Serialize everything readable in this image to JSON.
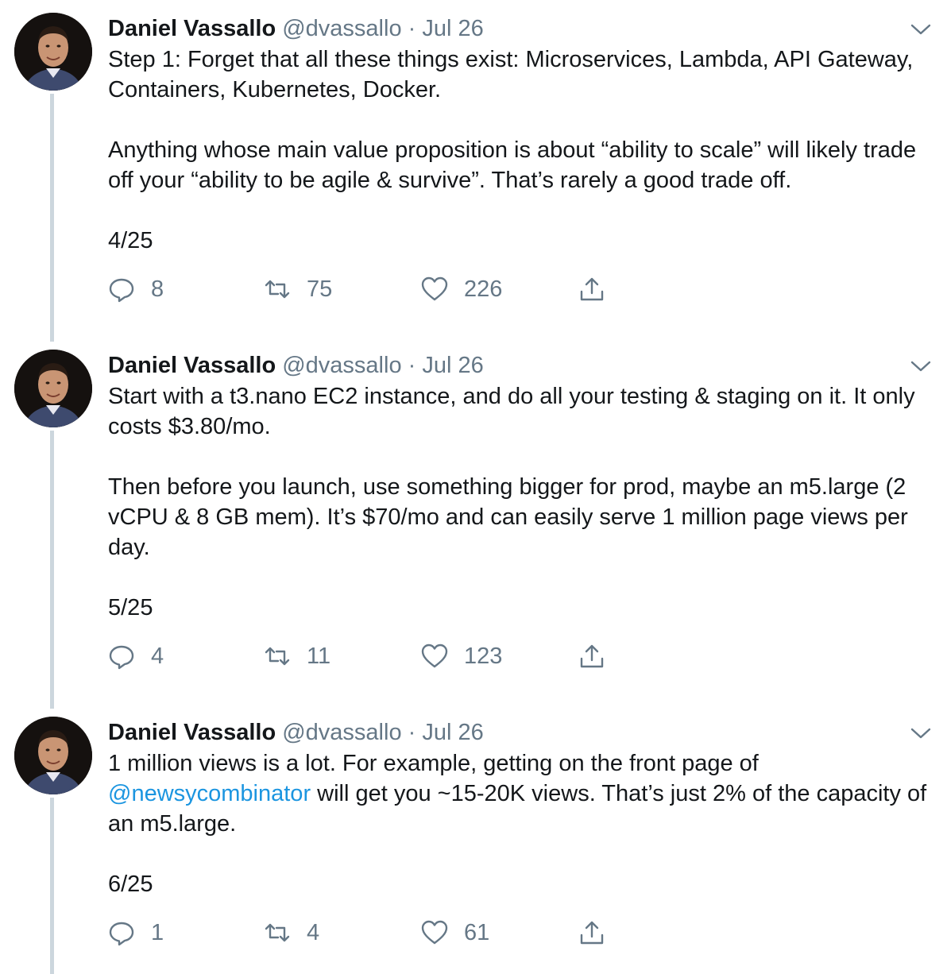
{
  "tweets": [
    {
      "name": "Daniel Vassallo",
      "handle": "@dvassallo",
      "dot": "·",
      "date": "Jul 26",
      "paragraphs": [
        "Step 1: Forget that all these things exist: Microservices, Lambda, API Gateway, Containers, Kubernetes, Docker.",
        "Anything whose main value proposition is about “ability to scale” will likely trade off your “ability to be agile & survive”. That’s rarely a good trade off.",
        "4/25"
      ],
      "replies": "8",
      "retweets": "75",
      "likes": "226"
    },
    {
      "name": "Daniel Vassallo",
      "handle": "@dvassallo",
      "dot": "·",
      "date": "Jul 26",
      "paragraphs": [
        "Start with a t3.nano EC2 instance, and do all your testing & staging on it. It only costs $3.80/mo.",
        "Then before you launch, use something bigger for prod, maybe an m5.large (2 vCPU & 8 GB mem). It’s $70/mo and can easily serve 1 million page views per day.",
        "5/25"
      ],
      "replies": "4",
      "retweets": "11",
      "likes": "123"
    },
    {
      "name": "Daniel Vassallo",
      "handle": "@dvassallo",
      "dot": "·",
      "date": "Jul 26",
      "text_a": "1 million views is a lot. For example, getting on the front page of ",
      "mention": "@newsycombinator",
      "text_b": " will get you ~15-20K views. That’s just 2% of the capacity of an m5.large.",
      "paragraphs": [
        "6/25"
      ],
      "replies": "1",
      "retweets": "4",
      "likes": "61"
    }
  ],
  "icons": [
    "reply-icon",
    "retweet-icon",
    "like-icon",
    "share-icon",
    "chevron-down-icon",
    "avatar"
  ],
  "colors": {
    "text": "#14171a",
    "secondary": "#657786",
    "link": "#1b95e0",
    "thread_line": "#ccd6dd"
  }
}
